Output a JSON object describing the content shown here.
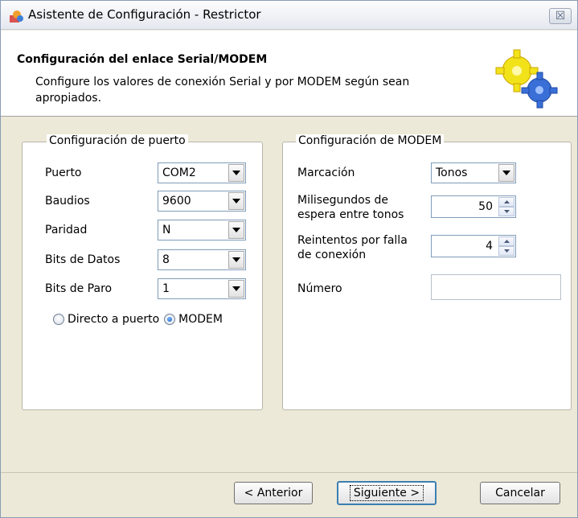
{
  "window": {
    "title": "Asistente de Configuración - Restrictor",
    "close_glyph": "☒"
  },
  "header": {
    "title": "Configuración del enlace Serial/MODEM",
    "description": "Configure los valores de conexión Serial y por MODEM según sean apropiados."
  },
  "port_group": {
    "legend": "Configuración de puerto",
    "fields": [
      {
        "label": "Puerto",
        "value": "COM2"
      },
      {
        "label": "Baudios",
        "value": "9600"
      },
      {
        "label": "Paridad",
        "value": "N"
      },
      {
        "label": "Bits de Datos",
        "value": "8"
      },
      {
        "label": "Bits de Paro",
        "value": "1"
      }
    ],
    "radio_direct": "Directo a puerto",
    "radio_modem": "MODEM",
    "selected": "MODEM"
  },
  "modem_group": {
    "legend": "Configuración de MODEM",
    "dial_label": "Marcación",
    "dial_value": "Tonos",
    "wait_label_1": "Milisegundos de",
    "wait_label_2": "espera entre tonos",
    "wait_value": "50",
    "retries_label_1": "Reintentos por falla",
    "retries_label_2": "de conexión",
    "retries_value": "4",
    "number_label": "Número",
    "number_value": ""
  },
  "buttons": {
    "back": "< Anterior",
    "next": "Siguiente >",
    "cancel": "Cancelar"
  },
  "icons": [
    "app-icon",
    "gears-icon",
    "close-icon",
    "dropdown-arrow-icon",
    "spin-up-icon",
    "spin-down-icon"
  ]
}
